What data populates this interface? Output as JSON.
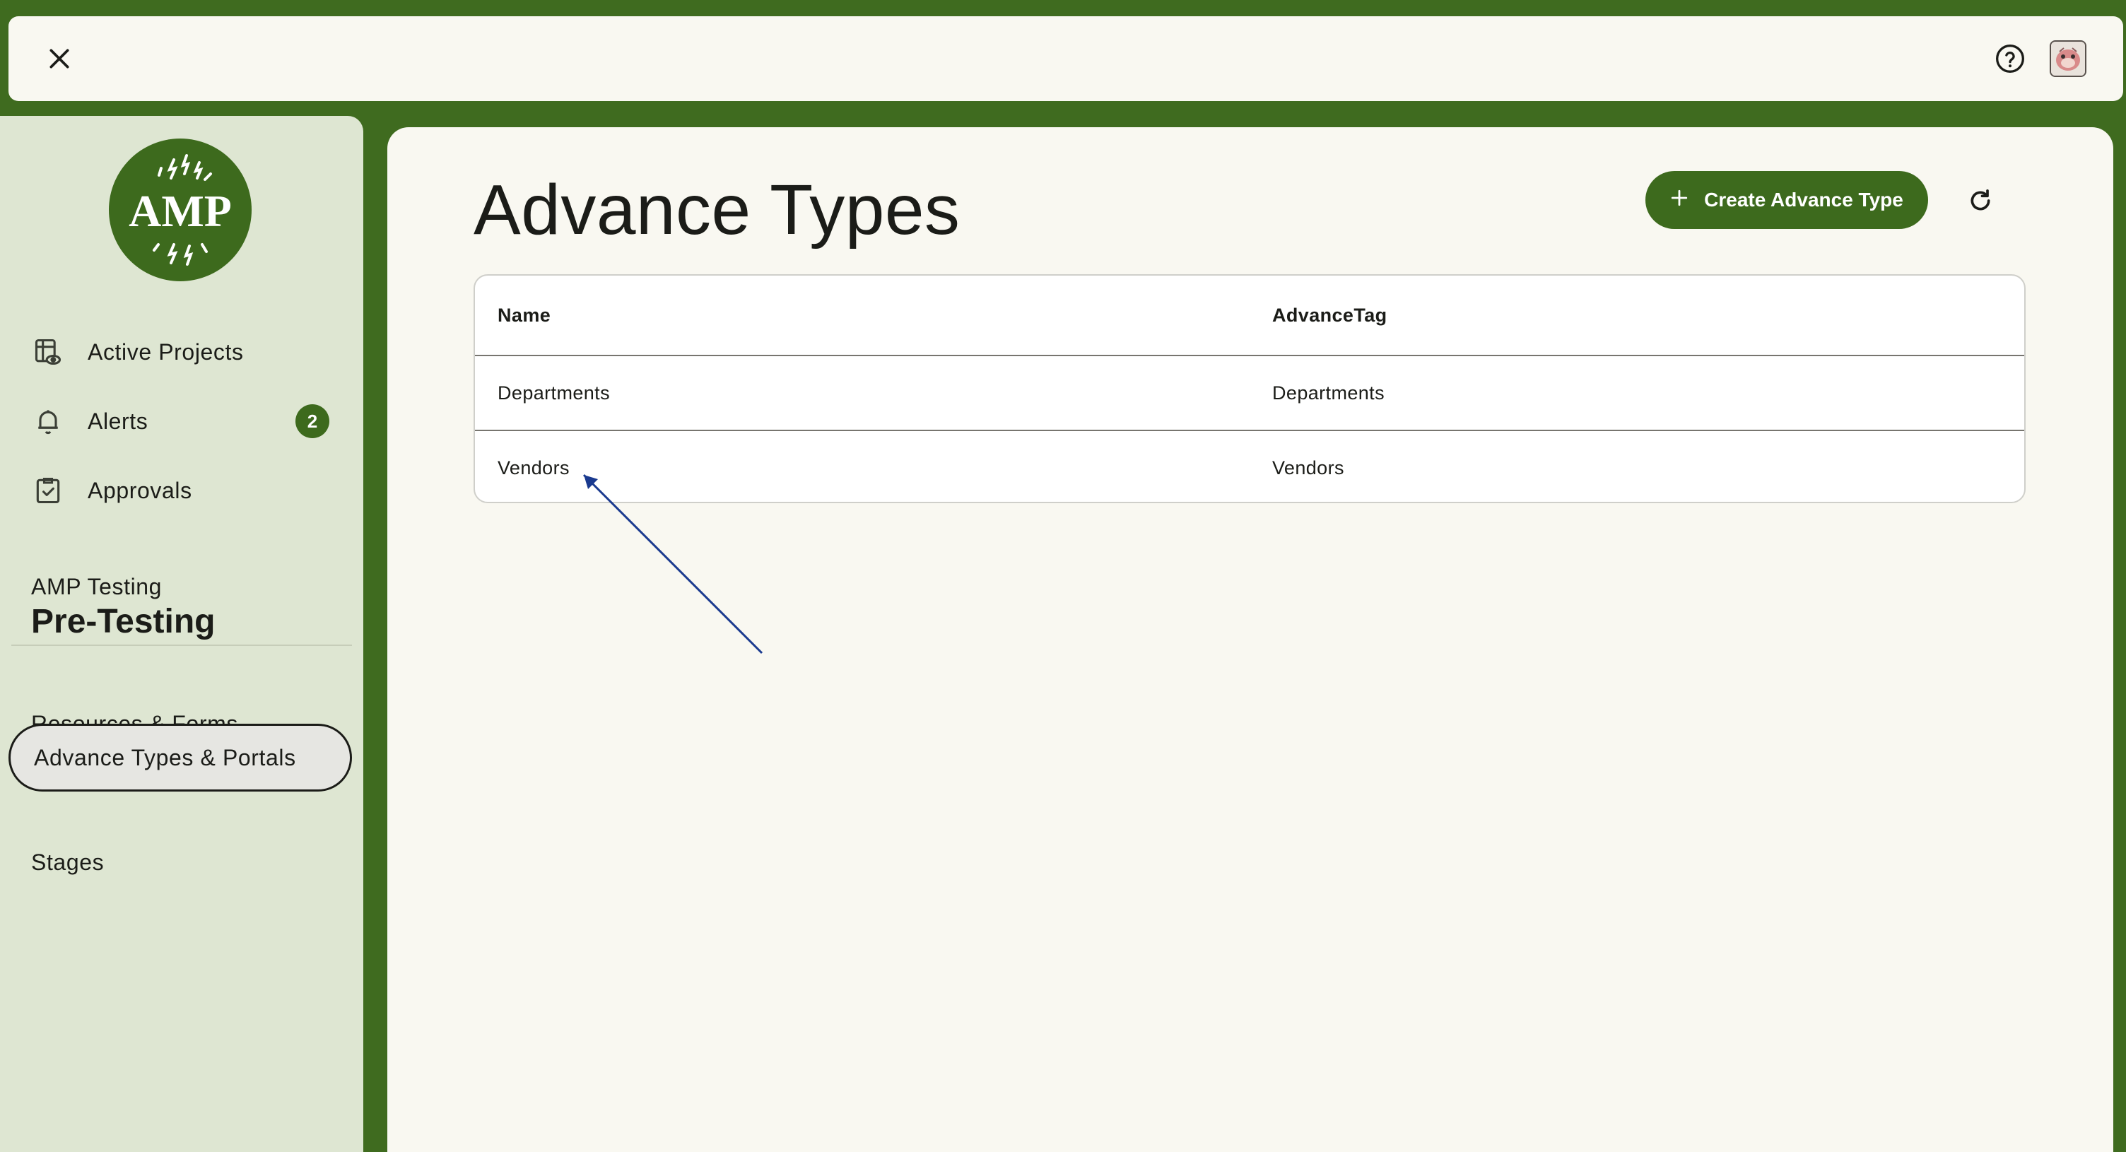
{
  "topbar": {
    "close_icon": "close-icon",
    "help_icon": "help-circle-icon",
    "avatar_icon": "user-avatar"
  },
  "sidebar": {
    "logo_text": "AMP",
    "nav": [
      {
        "label": "Active Projects",
        "icon": "projects-eye-icon"
      },
      {
        "label": "Alerts",
        "icon": "bell-icon",
        "badge": "2"
      },
      {
        "label": "Approvals",
        "icon": "clipboard-check-icon"
      }
    ],
    "project": {
      "subtitle": "AMP Testing",
      "title": "Pre-Testing"
    },
    "sub_nav": [
      {
        "label": "Resources & Forms",
        "active": false
      },
      {
        "label": "Advance Types & Portals",
        "active": true
      },
      {
        "label": "Stages",
        "active": false
      }
    ]
  },
  "main": {
    "title": "Advance Types",
    "create_button": "Create Advance Type",
    "refresh_icon": "refresh-icon",
    "table": {
      "columns": [
        "Name",
        "AdvanceTag"
      ],
      "rows": [
        [
          "Departments",
          "Departments"
        ],
        [
          "Vendors",
          "Vendors"
        ]
      ]
    }
  },
  "colors": {
    "brand_green": "#3d6a1d",
    "frame_green": "#3f6b1f",
    "sidebar_bg": "#dee6d2",
    "surface": "#f9f8f1",
    "annotation_arrow": "#1a3a8f"
  }
}
